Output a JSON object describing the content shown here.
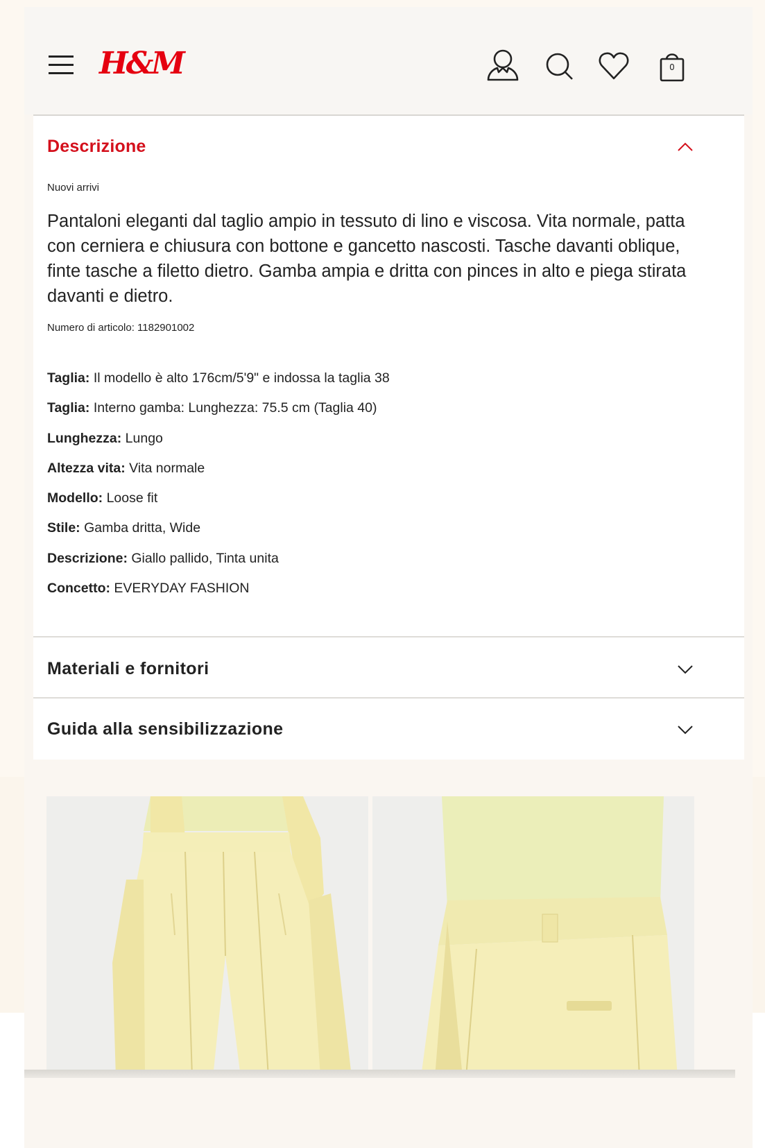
{
  "header": {
    "logo": "H&M",
    "bag_count": "0"
  },
  "description": {
    "title": "Descrizione",
    "badge": "Nuovi arrivi",
    "text": "Pantaloni eleganti dal taglio ampio in tessuto di lino e viscosa. Vita normale, patta con cerniera e chiusura con bottone e gancetto nascosti. Tasche davanti oblique, finte tasche a filetto dietro. Gamba ampia e dritta con pinces in alto e piega stirata davanti e dietro.",
    "article_number": "Numero di articolo: 1182901002",
    "specs": [
      {
        "label": "Taglia:",
        "value": " Il modello è alto 176cm/5'9\" e indossa la taglia 38"
      },
      {
        "label": "Taglia:",
        "value": " Interno gamba: Lunghezza: 75.5 cm (Taglia 40)"
      },
      {
        "label": "Lunghezza:",
        "value": " Lungo"
      },
      {
        "label": "Altezza vita:",
        "value": " Vita normale"
      },
      {
        "label": "Modello:",
        "value": " Loose fit"
      },
      {
        "label": "Stile:",
        "value": " Gamba dritta, Wide"
      },
      {
        "label": "Descrizione:",
        "value": " Giallo pallido, Tinta unita"
      },
      {
        "label": "Concetto:",
        "value": " EVERYDAY FASHION"
      }
    ]
  },
  "accordions": {
    "materials": "Materiali e fornitori",
    "care": "Guida alla sensibilizzazione"
  },
  "colors": {
    "brand_red": "#e50010",
    "accent_red": "#d4101c",
    "product_yellow": "#f4eeb5"
  },
  "icons": [
    "menu-icon",
    "account-icon",
    "search-icon",
    "heart-icon",
    "shopping-bag-icon",
    "chevron-up-icon",
    "chevron-down-icon"
  ]
}
